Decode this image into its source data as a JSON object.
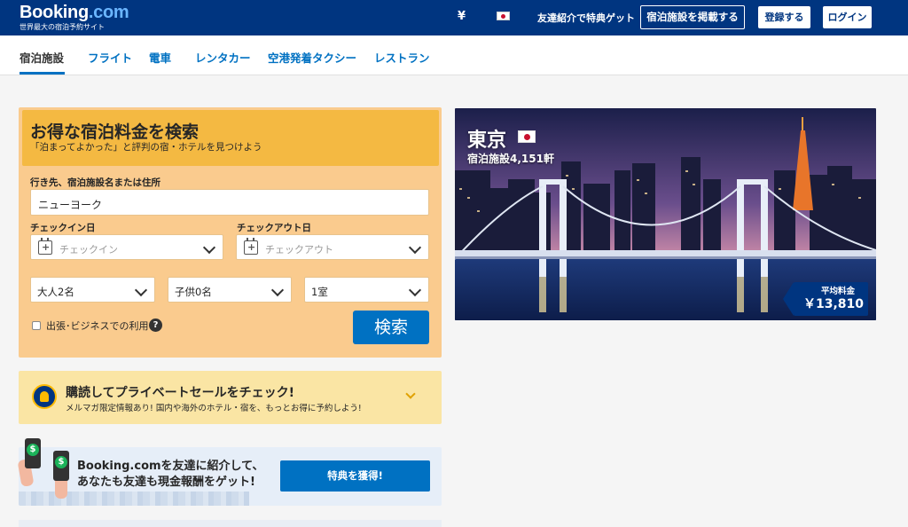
{
  "header": {
    "logo_main": "Booking",
    "logo_dot": ".com",
    "logo_sub": "世界最大の宿泊予約サイト",
    "currency": "¥",
    "refer_link": "友達紹介で特典ゲット",
    "list_property": "宿泊施設を掲載する",
    "register": "登録する",
    "login": "ログイン"
  },
  "nav": {
    "items": [
      "宿泊施設",
      "フライト",
      "電車",
      "レンタカー",
      "空港発着タクシー",
      "レストラン"
    ]
  },
  "search": {
    "title": "お得な宿泊料金を検索",
    "subtitle": "「泊まってよかった」と評判の宿・ホテルを見つけよう",
    "dest_label": "行き先、宿泊施設名または住所",
    "dest_value": "ニューヨーク",
    "checkin_label": "チェックイン日",
    "checkin_placeholder": "チェックイン",
    "checkout_label": "チェックアウト日",
    "checkout_placeholder": "チェックアウト",
    "adults": "大人2名",
    "children": "子供0名",
    "rooms": "1室",
    "business_label": "出張･ビジネスでの利用",
    "help": "?",
    "button": "検索"
  },
  "newsletter": {
    "title": "購読してプライベートセールをチェック!",
    "subtitle": "メルマガ限定情報あり! 国内や海外のホテル・宿を、もっとお得に予約しよう!"
  },
  "referral": {
    "text": "Booking.comを友達に紹介して、あなたも友達も現金報酬をゲット!",
    "button": "特典を獲得!"
  },
  "destination": {
    "city": "東京",
    "properties": "宿泊施設4,151軒",
    "price_label": "平均料金",
    "price_value": "￥13,810"
  },
  "colors": {
    "brand_blue": "#003580",
    "link_blue": "#0071c2",
    "panel_orange": "#facb8e",
    "head_yellow": "#f4b942"
  }
}
